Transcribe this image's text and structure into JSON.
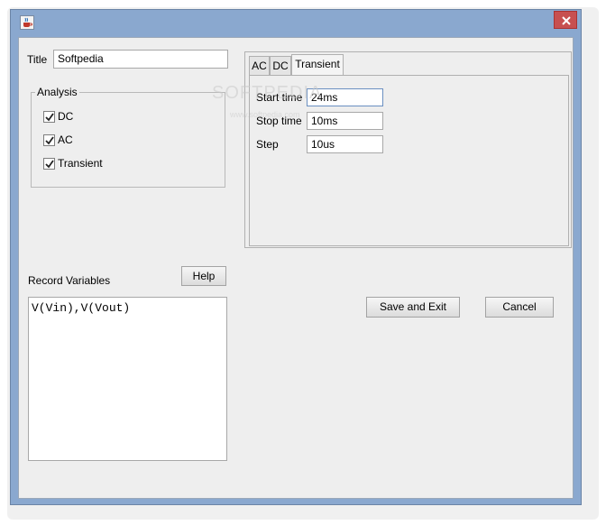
{
  "titlebar": {
    "app_icon": "java-cup-icon",
    "close_icon": "close-icon"
  },
  "form": {
    "title_label": "Title",
    "title_value": "Softpedia",
    "analysis": {
      "group_label": "Analysis",
      "options": [
        {
          "label": "DC",
          "checked": true
        },
        {
          "label": "AC",
          "checked": true
        },
        {
          "label": "Transient",
          "checked": true
        }
      ]
    },
    "record_variables_label": "Record Variables",
    "help_label": "Help",
    "record_variables_value": "V(Vin),V(Vout)"
  },
  "tabs": {
    "items": [
      "AC",
      "DC",
      "Transient"
    ],
    "active": "Transient",
    "transient": {
      "start_label": "Start time",
      "start_value": "24ms",
      "stop_label": "Stop time",
      "stop_value": "10ms",
      "step_label": "Step",
      "step_value": "10us"
    }
  },
  "buttons": {
    "save": "Save and Exit",
    "cancel": "Cancel"
  },
  "watermark": {
    "text": "SOFTPEDIA",
    "sub": "www.softpedia.com"
  }
}
